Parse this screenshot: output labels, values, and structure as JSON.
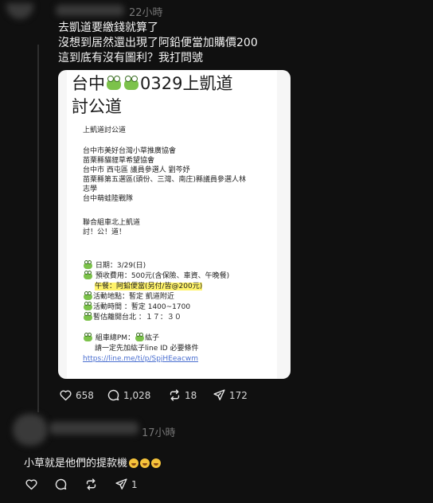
{
  "post": {
    "time": "22小時",
    "lines": [
      "去凱道要繳錢就算了",
      "沒想到居然還出現了阿鉛便當加購價200",
      "這到底有沒有圖利？我打問號"
    ],
    "image": {
      "title_line1_prefix": "台中",
      "title_line1_suffix": "0329上凱道",
      "title_line2": "討公道",
      "lines": [
        "上凱道討公道",
        "台中市美好台灣小草推廣協會",
        "苗栗縣貓貍草希望協會",
        "台中市 西屯區 議員參選人 劉芩妤",
        "苗栗縣第五選區(頭份、三灣、南庄)縣議員參選人林",
        "志學",
        "台中萌蛙陸戰隊",
        "聯合組車北上凱道",
        "討！公！道！",
        "日期：3/29(日)",
        "預收費用：500元(含保險、車資、午晚餐)",
        "午餐：阿鉛便當(另付/皆@200元)",
        "活動地點：暫定 凱道附近",
        "活動時間 ：暫定 1400~1700",
        "暫估離開台北 ：１７：３０",
        "組車總PM：",
        "紘子",
        "請一定先加紘子line ID  必要條件",
        "https://line.me/ti/p/SpjHEeacwm"
      ]
    },
    "stats": {
      "likes": "658",
      "comments": "1,028",
      "reposts": "18",
      "shares": "172"
    }
  },
  "reply": {
    "time": "17小時",
    "text": "小草就是他們的提款機",
    "stats": {
      "shares": "1"
    }
  }
}
